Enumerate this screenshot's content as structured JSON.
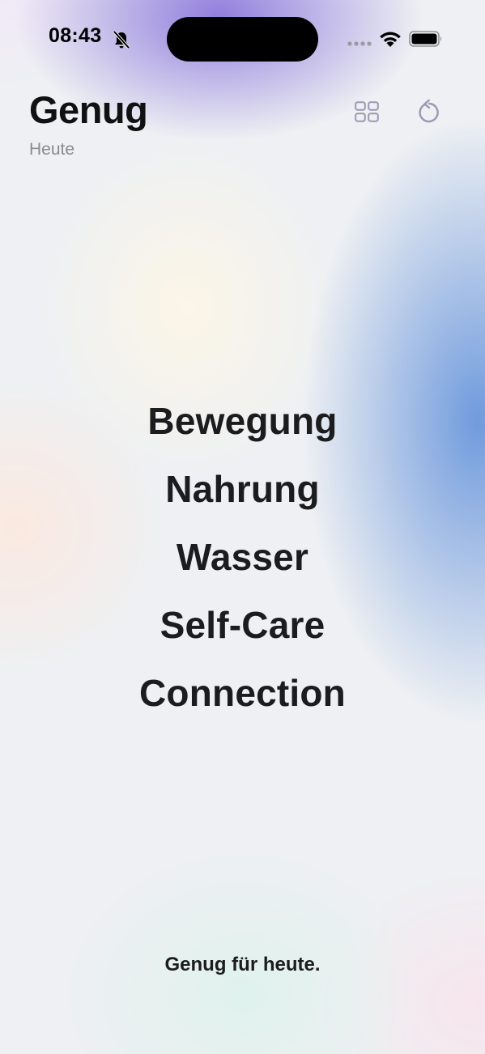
{
  "status_bar": {
    "time": "08:43",
    "icons": [
      "bell-slash-icon",
      "cellular-signal-icon",
      "wifi-icon",
      "battery-icon"
    ]
  },
  "header": {
    "title": "Genug",
    "subtitle": "Heute",
    "actions": [
      "grid-view-icon",
      "reset-icon"
    ]
  },
  "categories": [
    {
      "label": "Bewegung"
    },
    {
      "label": "Nahrung"
    },
    {
      "label": "Wasser"
    },
    {
      "label": "Self-Care"
    },
    {
      "label": "Connection"
    }
  ],
  "footer": {
    "text": "Genug für heute."
  },
  "colors": {
    "text_primary": "#1c1c1e",
    "text_secondary": "#8a8a90",
    "icon_muted": "#9a98b4",
    "gradient_purple": "#8c78dc",
    "gradient_blue": "#6996dc",
    "gradient_cream": "#fcf6e6"
  }
}
